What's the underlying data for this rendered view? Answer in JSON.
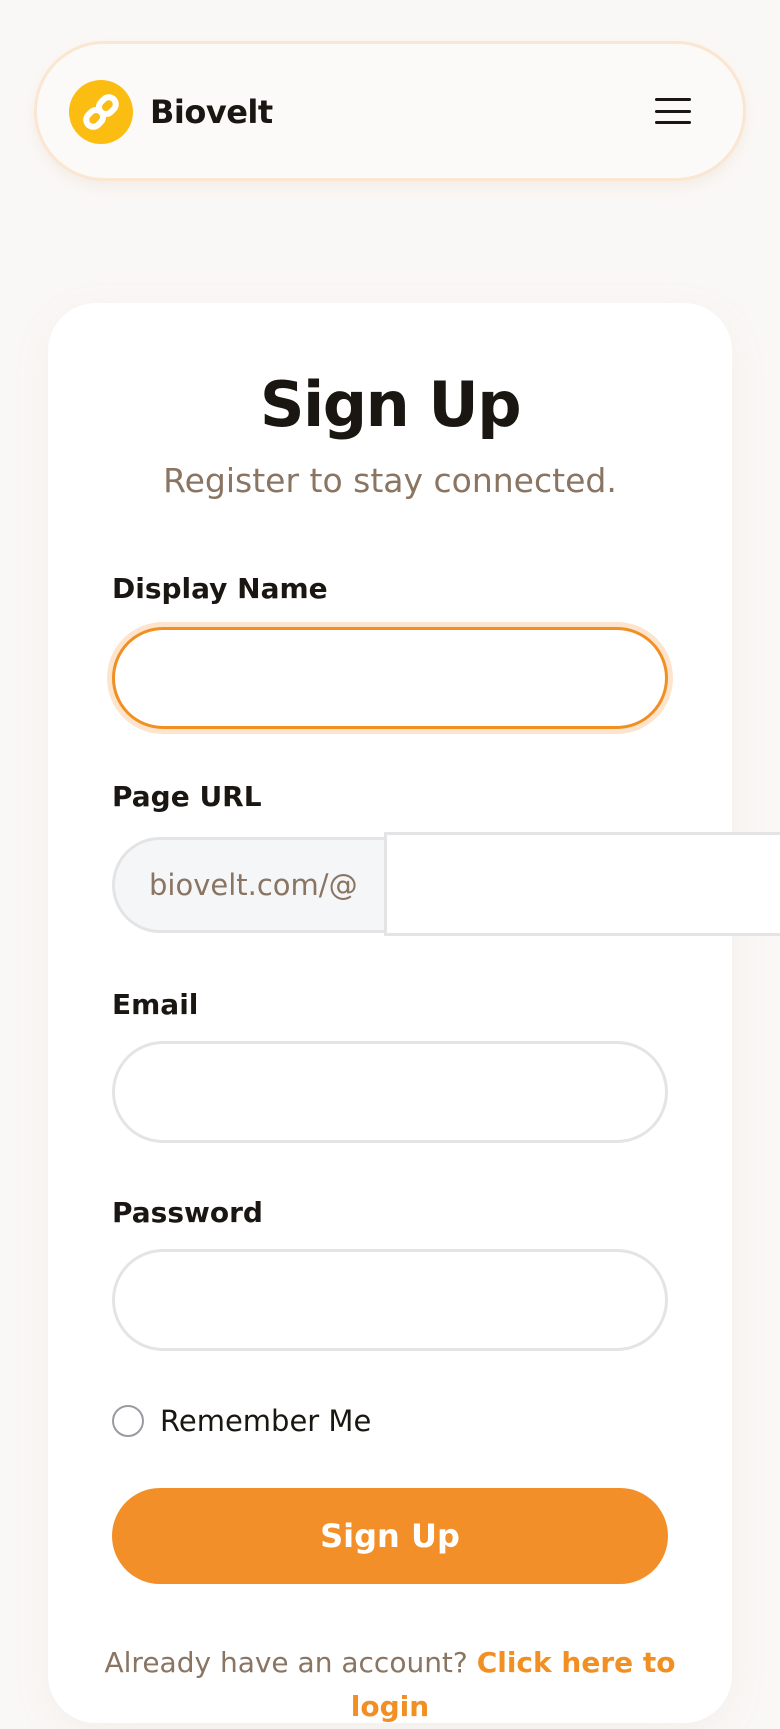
{
  "header": {
    "brand": "Biovelt",
    "logo_icon": "link-icon",
    "menu_icon": "hamburger-menu-icon"
  },
  "form": {
    "title": "Sign Up",
    "subtitle": "Register to stay connected.",
    "display_name": {
      "label": "Display Name",
      "value": ""
    },
    "page_url": {
      "label": "Page URL",
      "prefix": "biovelt.com/@",
      "value": ""
    },
    "email": {
      "label": "Email",
      "value": ""
    },
    "password": {
      "label": "Password",
      "value": ""
    },
    "remember_me": {
      "label": "Remember Me",
      "checked": false
    },
    "submit_label": "Sign Up",
    "footer_prompt": "Already have an account?",
    "footer_link": "Click here to login"
  },
  "colors": {
    "accent": "#f38f28",
    "logo": "#fbbd12",
    "muted_text": "#8a7462"
  }
}
